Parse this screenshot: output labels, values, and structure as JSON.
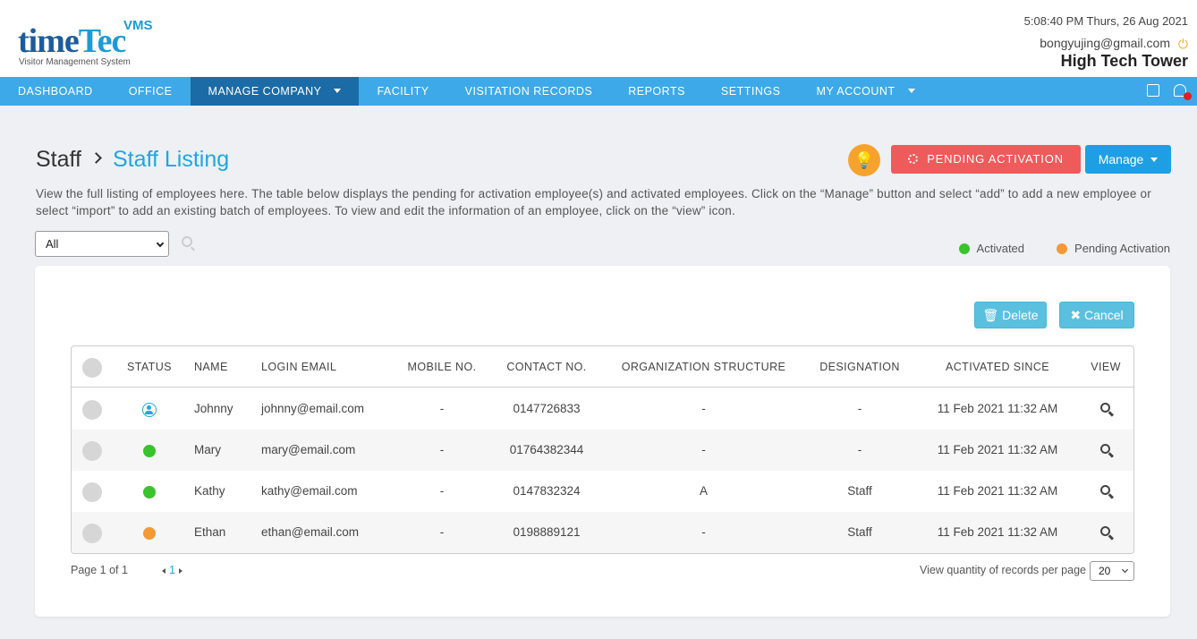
{
  "brand": {
    "name_part1": "time",
    "name_part2": "Tec",
    "product": "VMS",
    "tagline": "Visitor Management System"
  },
  "header": {
    "datetime": "5:08:40 PM  Thurs, 26 Aug 2021",
    "user_email": "bongyujing@gmail.com",
    "company": "High Tech Tower"
  },
  "nav": {
    "items": [
      {
        "label": "DASHBOARD"
      },
      {
        "label": "OFFICE"
      },
      {
        "label": "MANAGE COMPANY"
      },
      {
        "label": "FACILITY"
      },
      {
        "label": "VISITATION RECORDS"
      },
      {
        "label": "REPORTS"
      },
      {
        "label": "SETTINGS"
      },
      {
        "label": "MY ACCOUNT"
      }
    ],
    "active_index": 2
  },
  "page": {
    "breadcrumb_parent": "Staff",
    "breadcrumb_current": "Staff Listing",
    "pending_button": "PENDING ACTIVATION",
    "manage_button": "Manage",
    "description": "View the full listing of employees here. The table below displays the pending for activation employee(s) and activated employees. Click on the “Manage” button and select “add” to add a new employee or select “import” to add an existing batch of employees. To view and edit the information of an employee, click on the “view” icon."
  },
  "filter": {
    "selected": "All"
  },
  "legend": {
    "activated": "Activated",
    "pending": "Pending Activation",
    "activated_color": "#3ac32d",
    "pending_color": "#f39a37"
  },
  "actions": {
    "delete_label": "Delete",
    "cancel_label": "Cancel"
  },
  "table": {
    "columns": [
      "STATUS",
      "NAME",
      "LOGIN EMAIL",
      "MOBILE NO.",
      "CONTACT NO.",
      "ORGANIZATION STRUCTURE",
      "DESIGNATION",
      "ACTIVATED SINCE",
      "VIEW"
    ],
    "rows": [
      {
        "status": "user-icon",
        "name": "Johnny",
        "email": "johnny@email.com",
        "mobile": "-",
        "contact": "0147726833",
        "org": "-",
        "designation": "-",
        "since": "11 Feb 2021 11:32 AM"
      },
      {
        "status": "activated",
        "name": "Mary",
        "email": "mary@email.com",
        "mobile": "-",
        "contact": "01764382344",
        "org": "-",
        "designation": "-",
        "since": "11 Feb 2021 11:32 AM"
      },
      {
        "status": "activated",
        "name": "Kathy",
        "email": "kathy@email.com",
        "mobile": "-",
        "contact": "0147832324",
        "org": "A",
        "designation": "Staff",
        "since": "11 Feb 2021 11:32 AM"
      },
      {
        "status": "pending",
        "name": "Ethan",
        "email": "ethan@email.com",
        "mobile": "-",
        "contact": "0198889121",
        "org": "-",
        "designation": "Staff",
        "since": "11 Feb 2021 11:32 AM"
      }
    ]
  },
  "pagination": {
    "page_info": "Page 1 of 1",
    "current_page": "1",
    "per_page_label": "View quantity of records per page",
    "per_page_value": "20"
  }
}
